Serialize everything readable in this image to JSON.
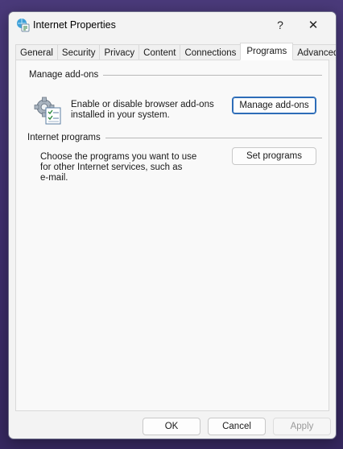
{
  "window": {
    "title": "Internet Properties",
    "help_glyph": "?",
    "close_glyph": "✕"
  },
  "tabs": [
    {
      "label": "General"
    },
    {
      "label": "Security"
    },
    {
      "label": "Privacy"
    },
    {
      "label": "Content"
    },
    {
      "label": "Connections"
    },
    {
      "label": "Programs",
      "active": true
    },
    {
      "label": "Advanced"
    }
  ],
  "manage_addons": {
    "heading": "Manage add-ons",
    "description_line1": "Enable or disable browser add-ons",
    "description_line2": "installed in your system.",
    "button_label": "Manage add-ons",
    "icon": "gear-checklist-icon"
  },
  "internet_programs": {
    "heading": "Internet programs",
    "description_line1": "Choose the programs you want to use",
    "description_line2": "for other Internet services, such as",
    "description_line3": "e-mail.",
    "button_label": "Set programs"
  },
  "footer": {
    "ok_label": "OK",
    "cancel_label": "Cancel",
    "apply_label": "Apply"
  }
}
